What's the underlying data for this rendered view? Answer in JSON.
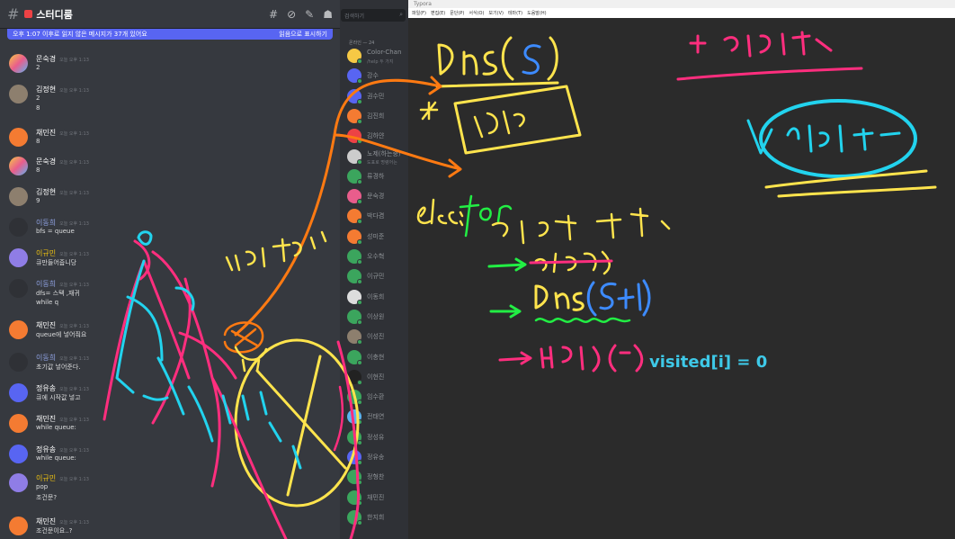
{
  "discord": {
    "channel_name": "스터디룸",
    "notice_text": "오후 1:07 이후로 읽지 않은 메시지가 37개 있어요",
    "notice_action": "읽음으로 표시하기",
    "search_placeholder": "검색하기",
    "online_header": "온라인 — 24",
    "messages": [
      {
        "user": "문숙경",
        "time": "오늘 오후 1:13",
        "lines": [
          "2"
        ]
      },
      {
        "user": "김정현",
        "time": "오늘 오후 1:13",
        "lines": [
          "2",
          "8"
        ]
      },
      {
        "user": "채민진",
        "time": "오늘 오후 1:13",
        "lines": [
          "8"
        ]
      },
      {
        "user": "문숙경",
        "time": "오늘 오후 1:13",
        "lines": [
          "8"
        ]
      },
      {
        "user": "김정현",
        "time": "오늘 오후 1:13",
        "lines": [
          "9"
        ]
      },
      {
        "user": "이동희",
        "time": "오늘 오후 1:13",
        "lines": [
          "bfs = queue"
        ]
      },
      {
        "user": "이규민",
        "time": "오늘 오후 1:13",
        "lines": [
          "큐만들어줍니당"
        ]
      },
      {
        "user": "이동희",
        "time": "오늘 오후 1:13",
        "lines": [
          "dfs= 스택 ,재귀",
          "while q"
        ]
      },
      {
        "user": "채민진",
        "time": "오늘 오후 1:13",
        "lines": [
          "queue에 넣어줘요"
        ]
      },
      {
        "user": "이동희",
        "time": "오늘 오후 1:13",
        "lines": [
          "초기값 넣어준다."
        ]
      },
      {
        "user": "정유송",
        "time": "오늘 오후 1:13",
        "lines": [
          "큐에 시작값 넣고"
        ]
      },
      {
        "user": "채민진",
        "time": "오늘 오후 1:13",
        "lines": [
          "while queue:"
        ]
      },
      {
        "user": "정유송",
        "time": "오늘 오후 1:13",
        "lines": [
          "while queue:"
        ]
      },
      {
        "user": "이규민",
        "time": "오늘 오후 1:13",
        "lines": [
          "pop",
          "조건문?"
        ]
      },
      {
        "user": "채민진",
        "time": "오늘 오후 1:13",
        "lines": [
          "조건문이요..?"
        ]
      }
    ],
    "members": [
      {
        "name": "Color-Chan",
        "sub": "/help 두 가지"
      },
      {
        "name": "강수"
      },
      {
        "name": "권수민"
      },
      {
        "name": "김진희"
      },
      {
        "name": "김하얀"
      },
      {
        "name": "노제(하는중)",
        "sub": "도표로 명령어는"
      },
      {
        "name": "류경하"
      },
      {
        "name": "문숙경"
      },
      {
        "name": "박다겸"
      },
      {
        "name": "성미준"
      },
      {
        "name": "오수혁"
      },
      {
        "name": "이규민"
      },
      {
        "name": "이동희"
      },
      {
        "name": "이상원"
      },
      {
        "name": "이성진"
      },
      {
        "name": "이충현"
      },
      {
        "name": "이현진"
      },
      {
        "name": "임수환"
      },
      {
        "name": "전태연"
      },
      {
        "name": "정성유"
      },
      {
        "name": "정유송"
      },
      {
        "name": "정형찬"
      },
      {
        "name": "채민진"
      },
      {
        "name": "한지희"
      }
    ]
  },
  "typora": {
    "title": "Typora",
    "menu": [
      "파일(F)",
      "편집(E)",
      "문단(P)",
      "서식(O)",
      "보기(V)",
      "테마(T)",
      "도움말(H)"
    ],
    "typed_text": "visited[i] = 0"
  },
  "colors": {
    "discord_bg": "#36393f",
    "notice_blue": "#5865f2",
    "ink_yellow": "#ffe44d",
    "ink_pink": "#ff2e7e",
    "ink_cyan": "#22d3ee",
    "ink_orange": "#ff7a12",
    "ink_green": "#22ee44",
    "ink_blue": "#3d8bff"
  }
}
